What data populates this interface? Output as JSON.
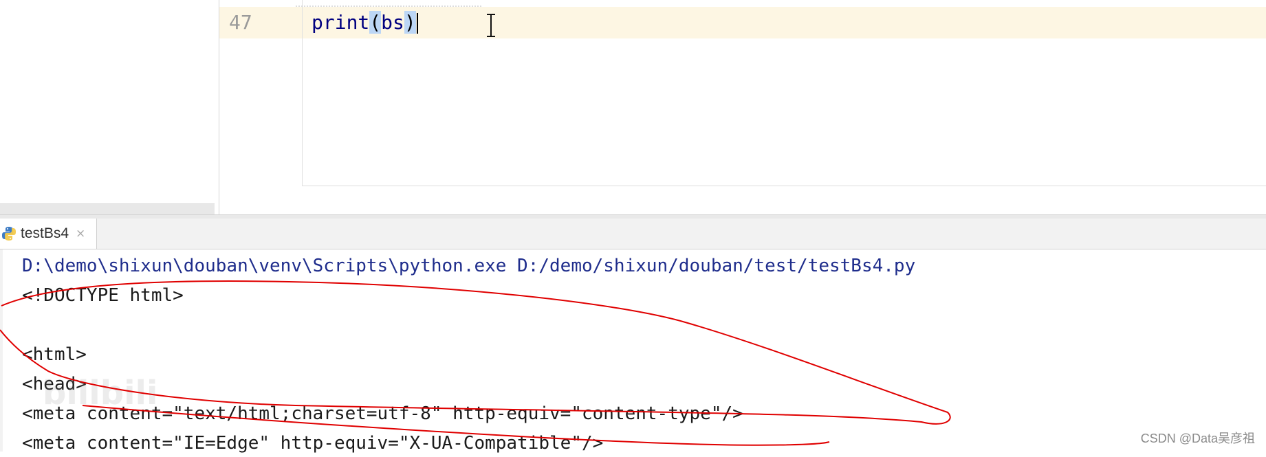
{
  "editor": {
    "line_number": "47",
    "code": {
      "func": "print",
      "open_paren": "(",
      "arg": "bs",
      "close_paren": ")"
    }
  },
  "run_panel": {
    "tab_label": "testBs4",
    "close_glyph": "×",
    "icon": "python-icon",
    "console_lines": [
      "D:\\demo\\shixun\\douban\\venv\\Scripts\\python.exe D:/demo/shixun/douban/test/testBs4.py",
      "<!DOCTYPE html>",
      "",
      "<html>",
      "<head>",
      "<meta content=\"text/html;charset=utf-8\" http-equiv=\"content-type\"/>",
      "<meta content=\"IE=Edge\" http-equiv=\"X-UA-Compatible\"/>"
    ]
  },
  "watermarks": {
    "faint": "bilibili",
    "csdn": "CSDN @Data吴彦祖"
  },
  "colors": {
    "current_line": "#fdf6e3",
    "annotation": "#e00000",
    "command_text": "#1f2d8c",
    "paren_highlight": "#bcd6f5"
  }
}
